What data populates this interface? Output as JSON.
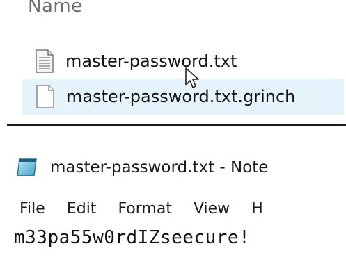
{
  "explorer": {
    "column_header": "Name",
    "files": [
      {
        "name": "master-password.txt",
        "icon": "text-file-icon",
        "selected": false
      },
      {
        "name": "master-password.txt.grinch",
        "icon": "blank-file-icon",
        "selected": true
      }
    ],
    "selection_color": "#e5f3fb"
  },
  "notepad": {
    "title": "master-password.txt - Note",
    "icon": "notepad-icon",
    "menu": [
      "File",
      "Edit",
      "Format",
      "View",
      "H"
    ],
    "content": "m33pa55w0rdIZseecure!"
  }
}
